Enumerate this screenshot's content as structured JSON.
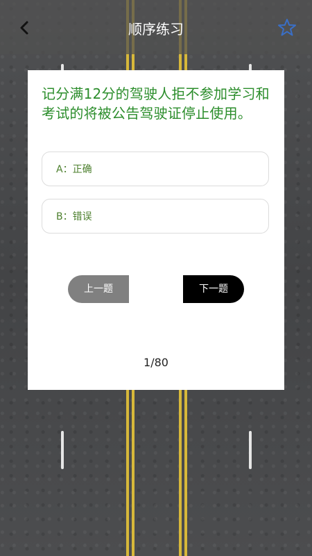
{
  "header": {
    "title": "顺序练习"
  },
  "question": {
    "text": "记分满12分的驾驶人拒不参加学习和考试的将被公告驾驶证停止使用。"
  },
  "options": [
    {
      "label": "A：正确"
    },
    {
      "label": "B：错误"
    }
  ],
  "buttons": {
    "prev": "上一题",
    "next": "下一题"
  },
  "progress": {
    "text": "1/80"
  },
  "colors": {
    "accent": "#2b8d2b",
    "star": "#3a6fc7"
  }
}
